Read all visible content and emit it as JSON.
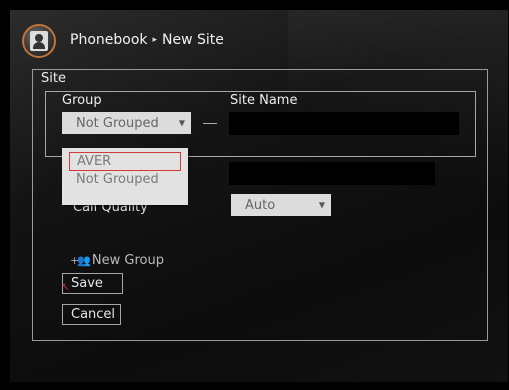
{
  "header": {
    "breadcrumb_root": "Phonebook",
    "breadcrumb_sep": "▸",
    "breadcrumb_page": "New Site"
  },
  "site": {
    "section_label": "Site",
    "group_label": "Group",
    "group_value": "Not Grouped",
    "site_name_label": "Site Name",
    "site_name_value": "",
    "group_options": [
      "AVER",
      "Not Grouped"
    ],
    "group_options_highlighted": "AVER",
    "number_value": "",
    "call_quality_label": "Call Quality",
    "call_quality_value": "Auto"
  },
  "actions": {
    "new_group_label": "New Group",
    "save_label": "Save",
    "cancel_label": "Cancel"
  },
  "icons": {
    "avatar": "phonebook-contact-icon",
    "new_group": "add-group-icon",
    "dropdown": "chevron-down-icon"
  },
  "colors": {
    "accent_ring": "#c0743a",
    "selection_border": "#d23a3a"
  }
}
